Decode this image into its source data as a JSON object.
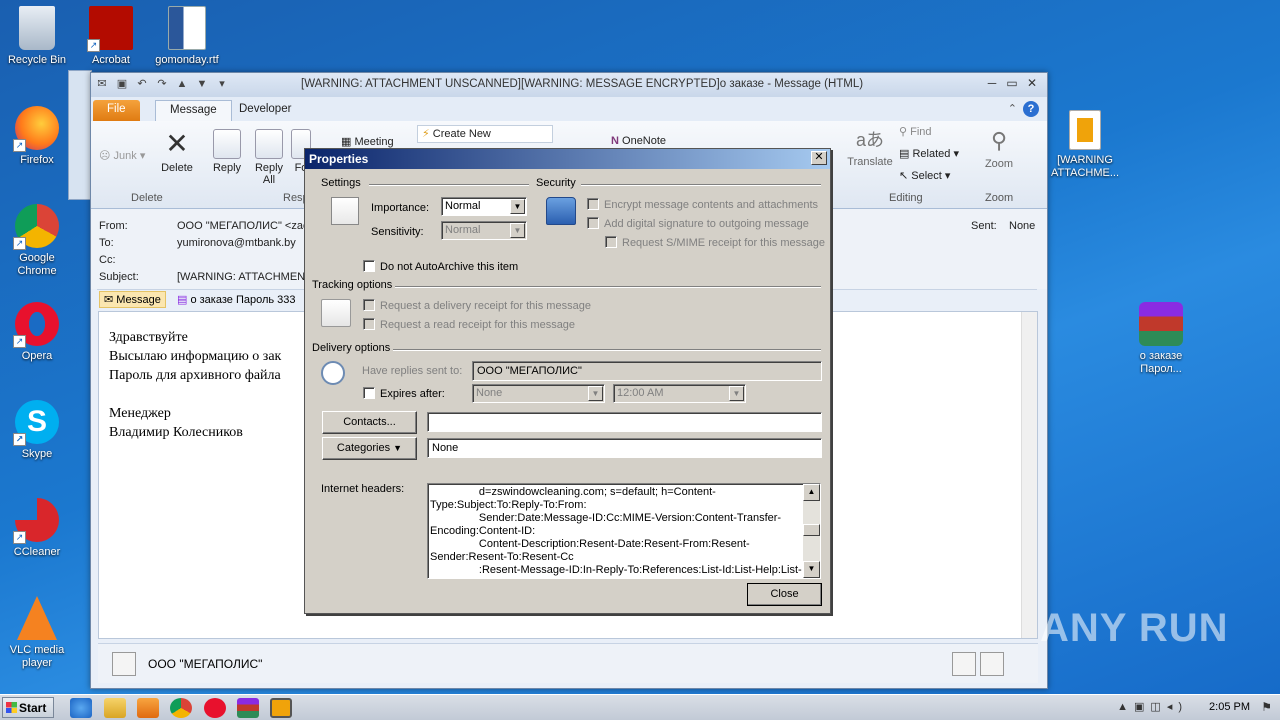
{
  "desktop": {
    "icons_left": [
      {
        "label": "Recycle Bin"
      },
      {
        "label": "Firefox"
      },
      {
        "label": "Google Chrome"
      },
      {
        "label": "Opera"
      },
      {
        "label": "Skype"
      },
      {
        "label": "CCleaner"
      },
      {
        "label": "VLC media player"
      }
    ],
    "icons_top": [
      {
        "label": "Acrobat"
      },
      {
        "label": "gomonday.rtf"
      }
    ],
    "icons_right": [
      {
        "label": "[WARNING ATTACHME..."
      },
      {
        "label": "о заказе Парол..."
      }
    ],
    "watermark": "ANY RUN"
  },
  "outlook": {
    "title": "[WARNING: ATTACHMENT UNSCANNED][WARNING: MESSAGE ENCRYPTED]о заказе  -  Message (HTML)",
    "tabs": {
      "file": "File",
      "message": "Message",
      "developer": "Developer"
    },
    "ribbon": {
      "junk": "Junk",
      "delete": "Delete",
      "delete_group": "Delete",
      "reply": "Reply",
      "reply_all": "Reply All",
      "forward": "Fo",
      "respond_group": "Resp",
      "meeting": "Meeting",
      "create_new": "Create New",
      "onenote": "OneNote",
      "find": "Find",
      "related": "Related",
      "select": "Select",
      "translate": "Translate",
      "editing_group": "Editing",
      "zoom": "Zoom",
      "zoom_group": "Zoom"
    },
    "header": {
      "from_label": "From:",
      "from_value": "ООО \"МЕГАПОЛИС\" <zaco",
      "to_label": "To:",
      "to_value": "yumironova@mtbank.by",
      "cc_label": "Cc:",
      "subject_label": "Subject:",
      "subject_value": "[WARNING: ATTACHMENT",
      "sent_label": "Sent:",
      "sent_value": "None"
    },
    "attachments": {
      "message_tab": "Message",
      "file": "о заказе Пароль 333"
    },
    "body_lines": [
      "Здравствуйте",
      "Высылаю информацию о зак",
      "Пароль для архивного файла",
      "",
      "Менеджер",
      "Владимир Колесников"
    ],
    "people_pane_name": "ООО \"МЕГАПОЛИС\""
  },
  "dialog": {
    "title": "Properties",
    "close_x": "✕",
    "settings_label": "Settings",
    "security_label": "Security",
    "importance_label": "Importance:",
    "importance_value": "Normal",
    "sensitivity_label": "Sensitivity:",
    "sensitivity_value": "Normal",
    "encrypt_label": "Encrypt message contents and attachments",
    "signature_label": "Add digital signature to outgoing message",
    "smime_label": "Request S/MIME receipt for this message",
    "autoarchive_label": "Do not AutoArchive this item",
    "tracking_label": "Tracking options",
    "delivery_receipt_label": "Request a delivery receipt for this message",
    "read_receipt_label": "Request a read receipt for this message",
    "delivery_label": "Delivery options",
    "replies_label": "Have replies sent to:",
    "replies_value": "ООО \"МЕГАПОЛИС\"",
    "expires_label": "Expires after:",
    "expires_date": "None",
    "expires_time": "12:00 AM",
    "contacts_button": "Contacts...",
    "contacts_value": "",
    "categories_button": "Categories",
    "categories_value": "None",
    "internet_headers_label": "Internet headers:",
    "internet_headers_lines": [
      "                d=zswindowcleaning.com; s=default; h=Content-",
      "Type:Subject:To:Reply-To:From:",
      "                Sender:Date:Message-ID:Cc:MIME-Version:Content-Transfer-",
      "Encoding:Content-ID:",
      "                Content-Description:Resent-Date:Resent-From:Resent-",
      "Sender:Resent-To:Resent-Cc",
      "                :Resent-Message-ID:In-Reply-To:References:List-Id:List-Help:List-"
    ],
    "close_button": "Close"
  },
  "taskbar": {
    "start": "Start",
    "clock": "2:05 PM"
  }
}
